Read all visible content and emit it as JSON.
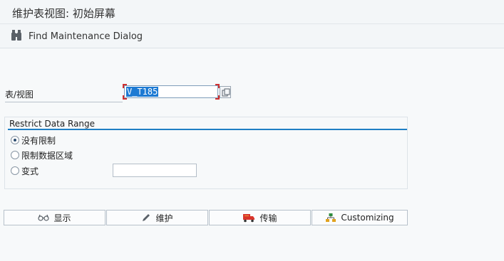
{
  "window": {
    "title": "维护表视图: 初始屏幕"
  },
  "toolbar": {
    "find_label": "Find Maintenance Dialog",
    "find_icon": "binoculars-icon"
  },
  "form": {
    "table_label": "表/视图",
    "table_value": "V_T185"
  },
  "restrict": {
    "title": "Restrict Data Range",
    "options": [
      {
        "label": "没有限制",
        "checked": true
      },
      {
        "label": "限制数据区域",
        "checked": false
      },
      {
        "label": "变式",
        "checked": false
      }
    ],
    "variant_value": ""
  },
  "actions": {
    "display": "显示",
    "maintain": "维护",
    "transport": "传输",
    "customizing": "Customizing"
  },
  "colors": {
    "accent": "#1f7fc4",
    "selection": "#1c7ad3",
    "required_marker": "#d03030"
  }
}
